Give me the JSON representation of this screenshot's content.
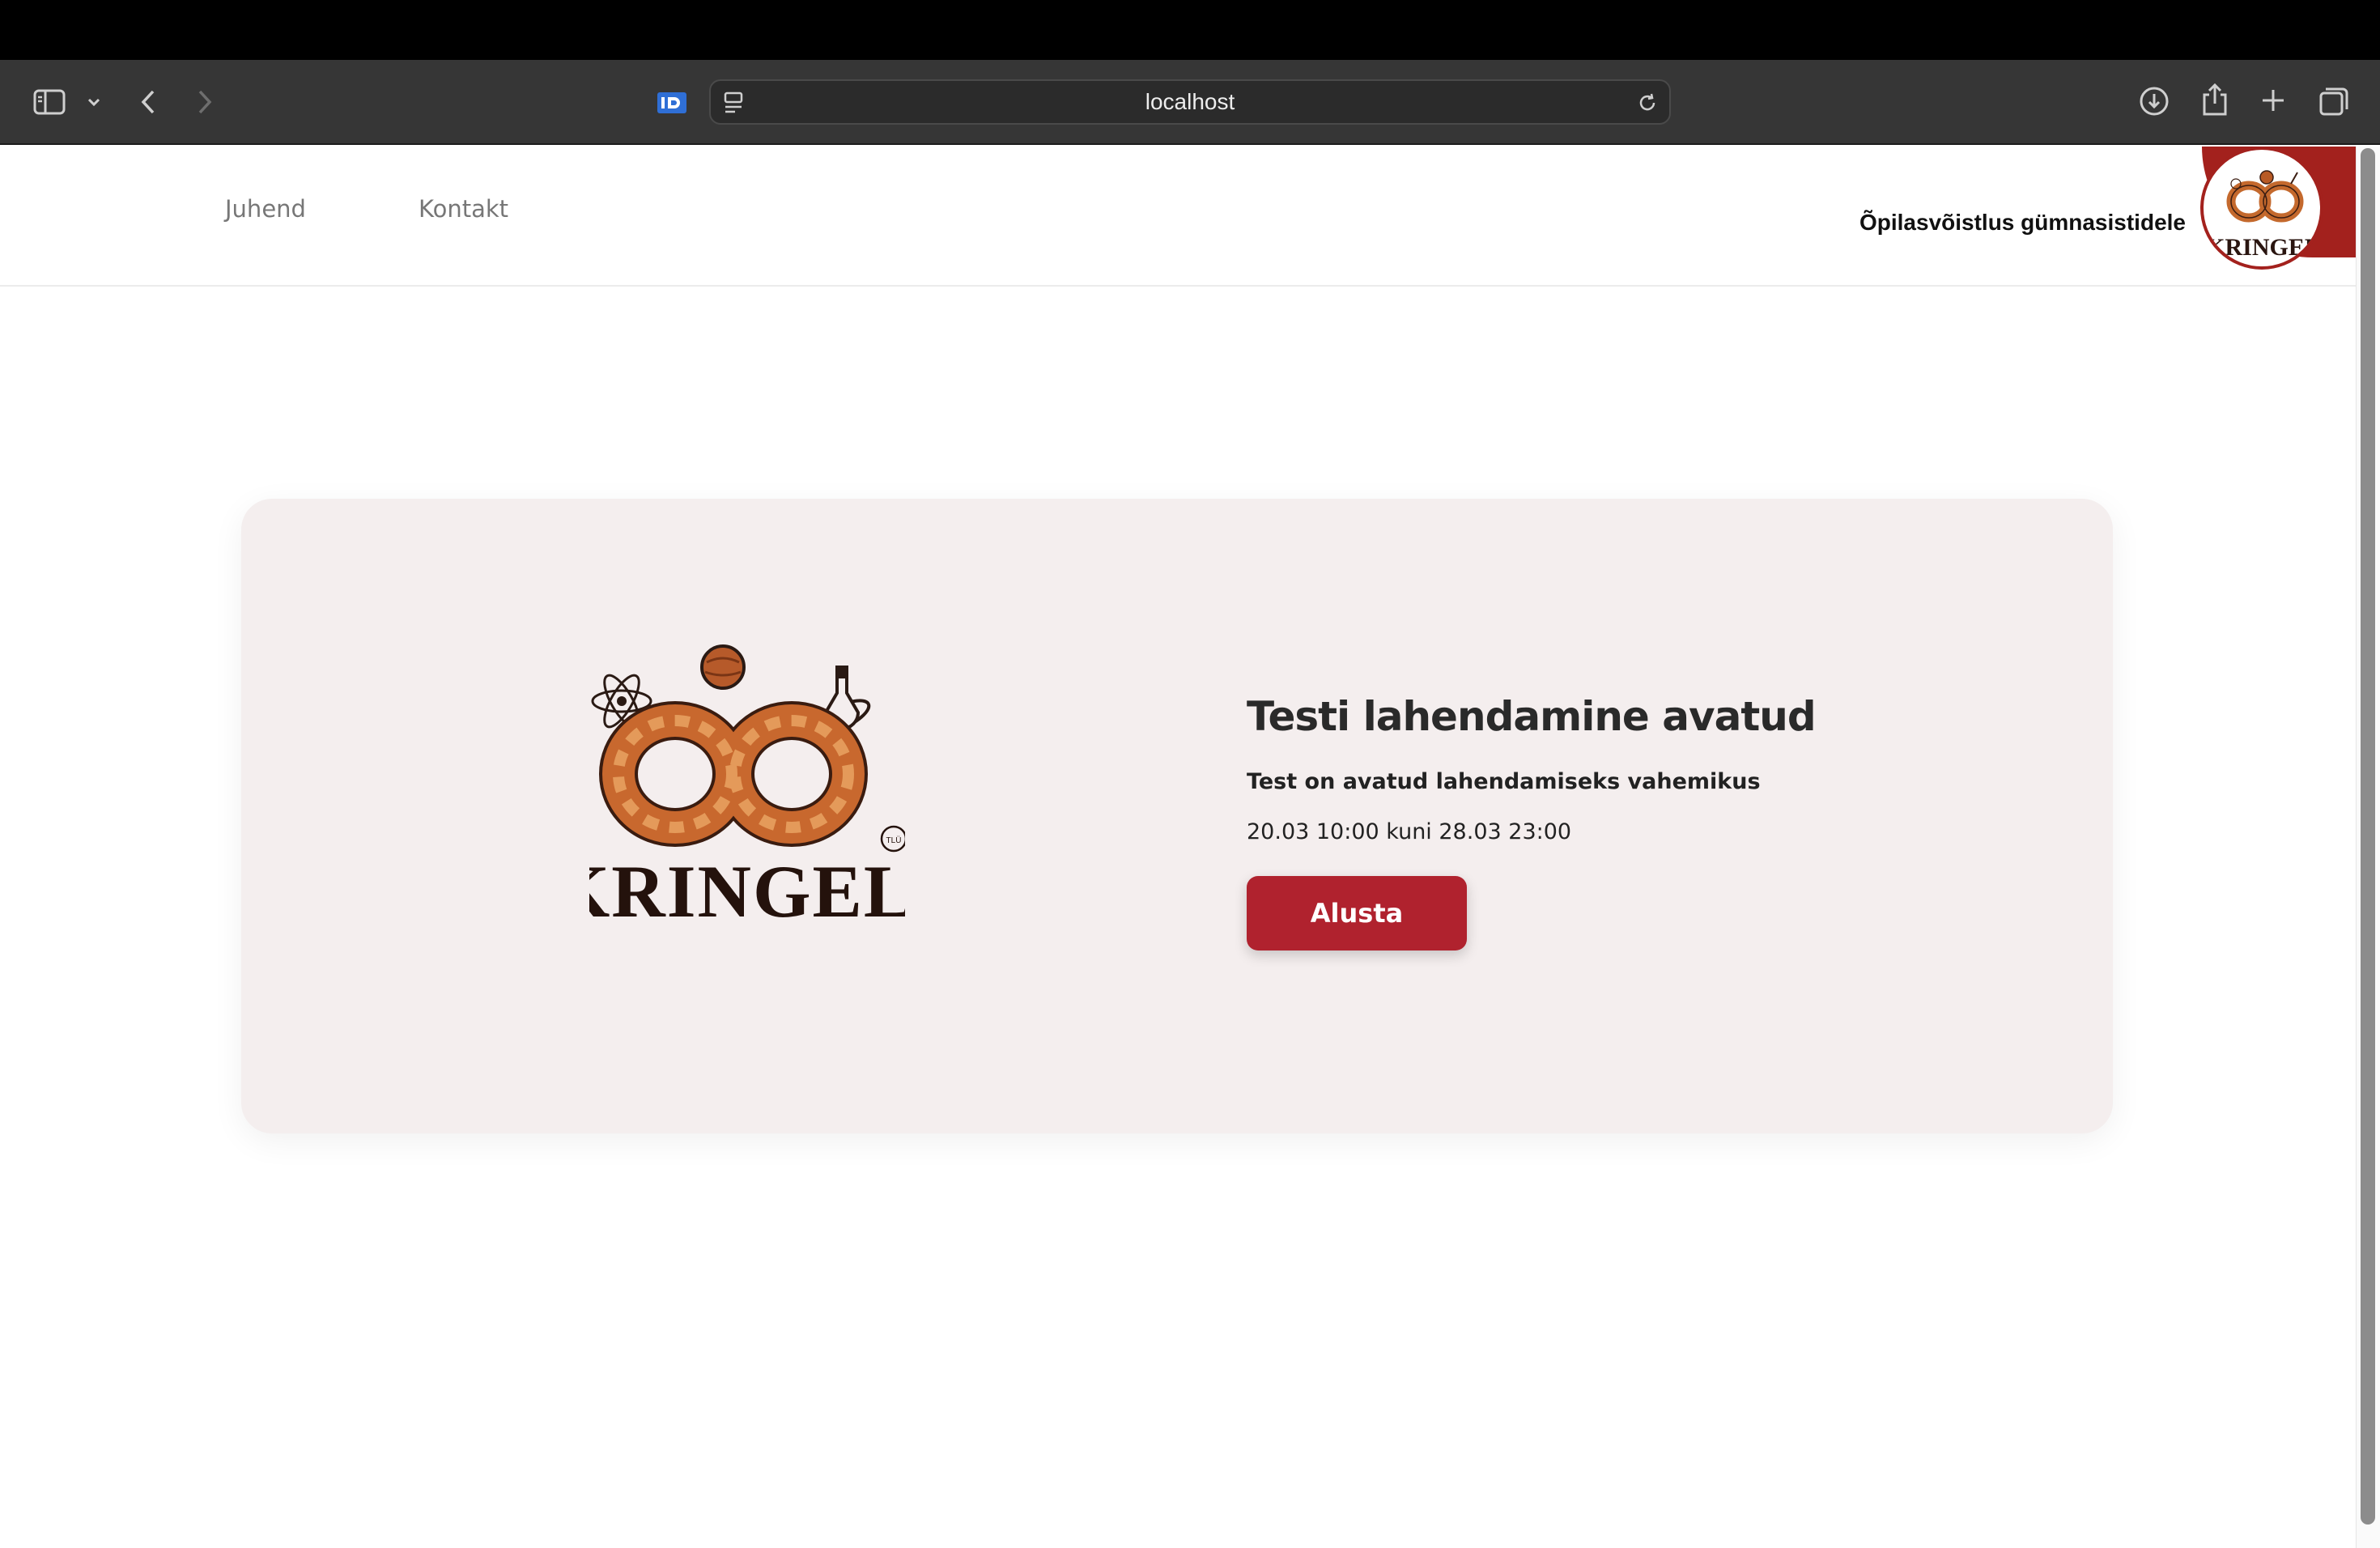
{
  "browser": {
    "url": "localhost"
  },
  "site": {
    "nav": [
      "Juhend",
      "Kontakt"
    ],
    "tagline": "Õpilasvõistlus gümnasistidele",
    "logo_text": "KRINGEL",
    "logo_mark": "TLÜ"
  },
  "card": {
    "title": "Testi lahendamine avatud",
    "subtitle": "Test on avatud lahendamiseks vahemikus",
    "dates": "20.03 10:00 kuni 28.03 23:00",
    "button_label": "Alusta"
  },
  "colors": {
    "accent": "#b0222e",
    "card_bg": "#f4eeee",
    "header_corner": "#a3211d"
  }
}
